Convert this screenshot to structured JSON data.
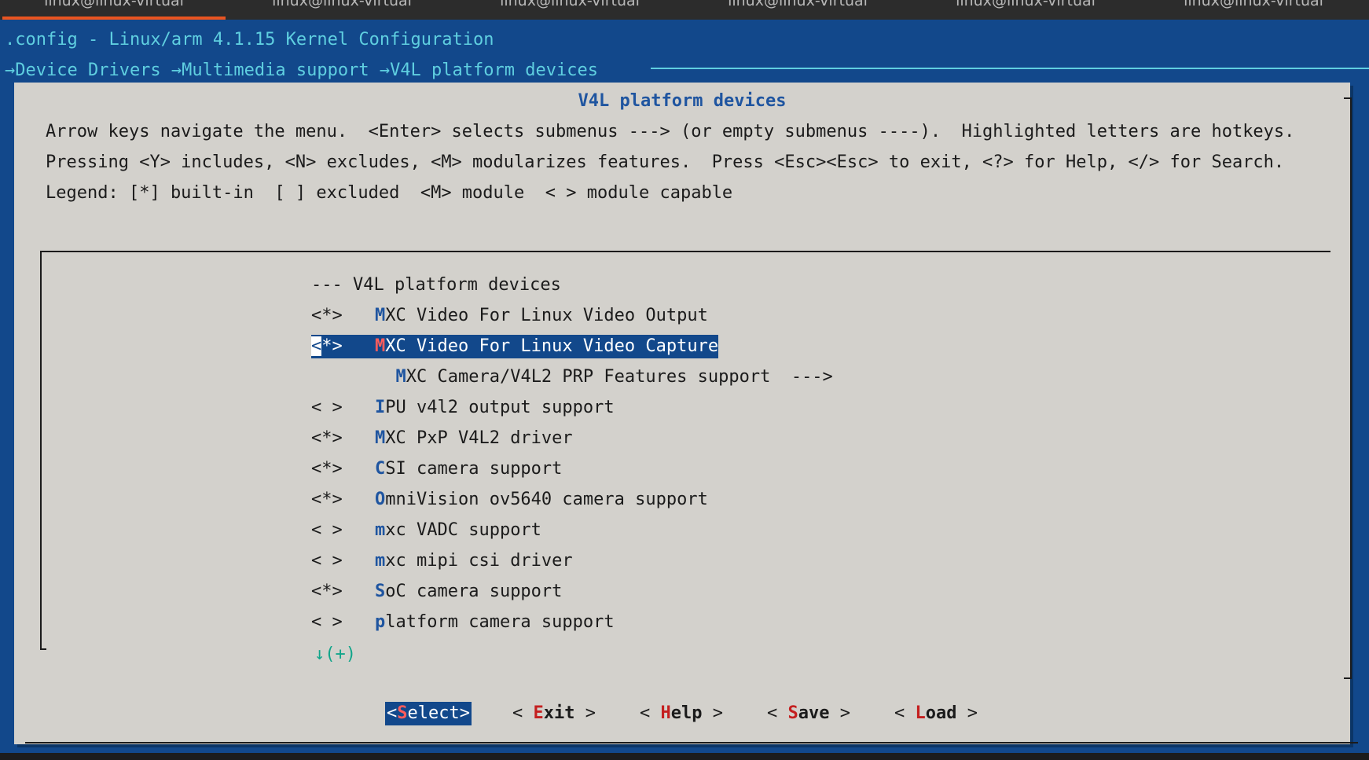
{
  "terminal": {
    "tabs": [
      {
        "label": "linux@linux-virtual"
      },
      {
        "label": "linux@linux-virtual"
      },
      {
        "label": "linux@linux-virtual"
      },
      {
        "label": "linux@linux-virtual"
      },
      {
        "label": "linux@linux-virtual"
      },
      {
        "label": "linux@linux-virtual"
      }
    ],
    "active_tab": 0
  },
  "header": {
    "config_title": ".config - Linux/arm 4.1.15 Kernel Configuration",
    "breadcrumb": "→Device Drivers →Multimedia support →V4L platform devices"
  },
  "dialog": {
    "title": "V4L platform devices",
    "help_lines": [
      "Arrow keys navigate the menu.  <Enter> selects submenus ---> (or empty submenus ----).  Highlighted letters are hotkeys.",
      "Pressing <Y> includes, <N> excludes, <M> modularizes features.  Press <Esc><Esc> to exit, <?> for Help, </> for Search.",
      "Legend: [*] built-in  [ ] excluded  <M> module  < > module capable"
    ],
    "menu": {
      "header": "--- V4L platform devices",
      "items": [
        {
          "prefix": "<*>",
          "hot": "M",
          "rest": "XC Video For Linux Video Output",
          "selected": false
        },
        {
          "prefix": "<*>",
          "hot": "M",
          "rest": "XC Video For Linux Video Capture",
          "selected": true
        },
        {
          "prefix": "",
          "indent": "  ",
          "hot": "M",
          "rest": "XC Camera/V4L2 PRP Features support  --->",
          "selected": false
        },
        {
          "prefix": "< >",
          "hot": "I",
          "rest": "PU v4l2 output support",
          "selected": false
        },
        {
          "prefix": "<*>",
          "hot": "M",
          "rest": "XC PxP V4L2 driver",
          "selected": false
        },
        {
          "prefix": "<*>",
          "hot": "C",
          "rest": "SI camera support",
          "selected": false
        },
        {
          "prefix": "<*>",
          "hot": "O",
          "rest": "mniVision ov5640 camera support",
          "selected": false
        },
        {
          "prefix": "< >",
          "hot": "m",
          "rest": "xc VADC support",
          "selected": false
        },
        {
          "prefix": "< >",
          "hot": "m",
          "rest": "xc mipi csi driver",
          "selected": false
        },
        {
          "prefix": "<*>",
          "hot": "S",
          "rest": "oC camera support",
          "selected": false
        },
        {
          "prefix": "< >",
          "hot": "p",
          "rest": "latform camera support",
          "selected": false
        }
      ],
      "more_indicator": "↓(+)"
    },
    "buttons": [
      {
        "open": "<",
        "hot": "S",
        "rest": "elect",
        "close": ">",
        "selected": true
      },
      {
        "open": "< ",
        "hot": "E",
        "rest": "xit",
        "close": " >",
        "selected": false
      },
      {
        "open": "< ",
        "hot": "H",
        "rest": "elp",
        "close": " >",
        "selected": false
      },
      {
        "open": "< ",
        "hot": "S",
        "rest": "ave",
        "close": " >",
        "selected": false
      },
      {
        "open": "< ",
        "hot": "L",
        "rest": "oad",
        "close": " >",
        "selected": false
      }
    ]
  },
  "colors": {
    "background": "#12488b",
    "dialog": "#d3d1cc",
    "hotkey": "#1f55a0",
    "button_hotkey": "#c41f1f",
    "header_text": "#5fcfe0",
    "tab_accent": "#e95420"
  }
}
